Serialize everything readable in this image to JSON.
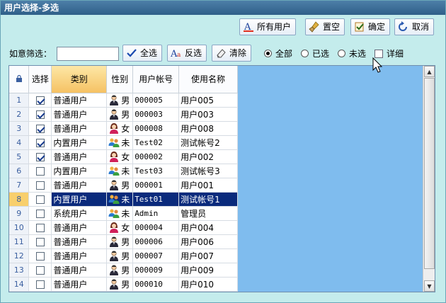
{
  "window": {
    "title": "用户选择-多选"
  },
  "toolbar": {
    "all_users": "所有用户",
    "clear_all": "置空",
    "ok": "确定",
    "cancel": "取消"
  },
  "filter": {
    "label": "如意筛选：",
    "value": "",
    "select_all": "全选",
    "invert": "反选",
    "clear": "清除",
    "radio_all": "全部",
    "radio_selected": "已选",
    "radio_unselected": "未选",
    "detail": "详细"
  },
  "grid": {
    "headers": {
      "select": "选择",
      "category": "类别",
      "gender": "性别",
      "account": "用户帐号",
      "name": "使用名称"
    },
    "rows": [
      {
        "idx": "1",
        "checked": true,
        "category": "普通用户",
        "gender": "男",
        "icon": "male-icon",
        "account": "000005",
        "name": "用户005"
      },
      {
        "idx": "2",
        "checked": true,
        "category": "普通用户",
        "gender": "男",
        "icon": "male-icon",
        "account": "000003",
        "name": "用户003"
      },
      {
        "idx": "3",
        "checked": true,
        "category": "普通用户",
        "gender": "女",
        "icon": "female-icon",
        "account": "000008",
        "name": "用户008"
      },
      {
        "idx": "4",
        "checked": true,
        "category": "内置用户",
        "gender": "未",
        "icon": "group-icon",
        "account": "Test02",
        "name": "测试帐号2"
      },
      {
        "idx": "5",
        "checked": true,
        "category": "普通用户",
        "gender": "女",
        "icon": "female-icon",
        "account": "000002",
        "name": "用户002"
      },
      {
        "idx": "6",
        "checked": false,
        "category": "内置用户",
        "gender": "未",
        "icon": "group-icon",
        "account": "Test03",
        "name": "测试帐号3"
      },
      {
        "idx": "7",
        "checked": false,
        "category": "普通用户",
        "gender": "男",
        "icon": "male-icon",
        "account": "000001",
        "name": "用户001"
      },
      {
        "idx": "8",
        "checked": false,
        "category": "内置用户",
        "gender": "未",
        "icon": "group-icon",
        "account": "Test01",
        "name": "测试帐号1",
        "selected": true
      },
      {
        "idx": "9",
        "checked": false,
        "category": "系统用户",
        "gender": "未",
        "icon": "group-icon",
        "account": "Admin",
        "name": "管理员"
      },
      {
        "idx": "10",
        "checked": false,
        "category": "普通用户",
        "gender": "女",
        "icon": "female-icon",
        "account": "000004",
        "name": "用户004"
      },
      {
        "idx": "11",
        "checked": false,
        "category": "普通用户",
        "gender": "男",
        "icon": "male-icon",
        "account": "000006",
        "name": "用户006"
      },
      {
        "idx": "12",
        "checked": false,
        "category": "普通用户",
        "gender": "男",
        "icon": "male-icon",
        "account": "000007",
        "name": "用户007"
      },
      {
        "idx": "13",
        "checked": false,
        "category": "普通用户",
        "gender": "男",
        "icon": "male-icon",
        "account": "000009",
        "name": "用户009"
      },
      {
        "idx": "14",
        "checked": false,
        "category": "普通用户",
        "gender": "男",
        "icon": "male-icon",
        "account": "000010",
        "name": "用户010"
      }
    ]
  },
  "colors": {
    "selected_row": "#0a2a7c",
    "sorted_header": "#f5c264",
    "grid_bg": "#7fbcee"
  }
}
